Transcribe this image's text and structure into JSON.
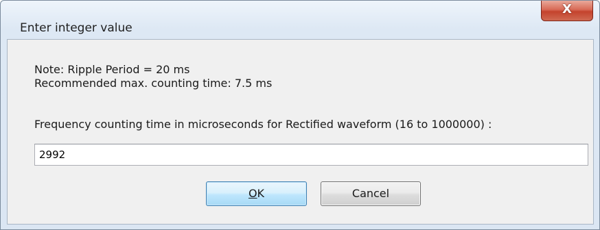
{
  "window": {
    "title": "Enter integer value",
    "close_glyph": "X"
  },
  "notes": {
    "line1": "Note: Ripple Period = 20 ms",
    "line2": "Recommended max. counting time: 7.5 ms"
  },
  "prompt": "Frequency counting time in microseconds for Rectified waveform (16 to 1000000) :",
  "input": {
    "value": "2992"
  },
  "buttons": {
    "ok_prefix": "",
    "ok_mnemonic": "O",
    "ok_rest": "K",
    "cancel_label": "Cancel"
  },
  "colors": {
    "close_button": "#c4432d",
    "ok_border": "#3c7fb1",
    "client_bg": "#f0f0f0"
  }
}
